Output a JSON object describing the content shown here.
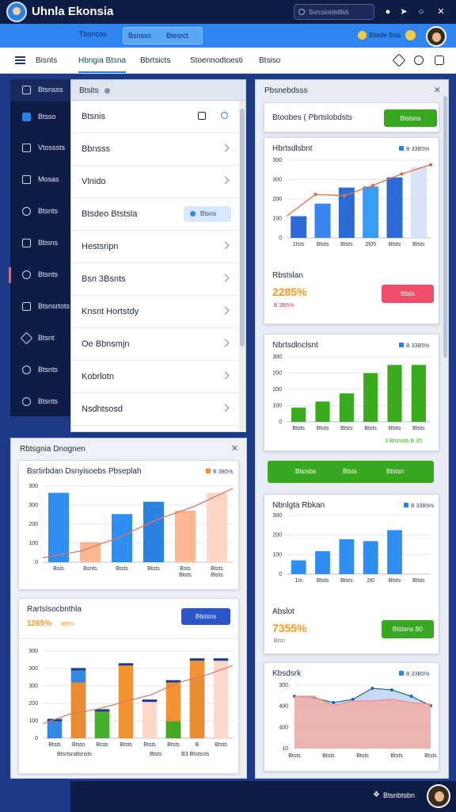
{
  "app": {
    "title": "Uhnla Ekonsia"
  },
  "titlebar": {
    "search_placeholder": "Ssrcsiotdslllsti"
  },
  "ribbon": {
    "button1": "Tboncos",
    "seg1": "Bsnsss",
    "seg2": "Btesrct",
    "user_label": "Bbsde Bsts"
  },
  "tabs": {
    "home": "Bisnts",
    "items": [
      {
        "label": "Hbngia Btsna",
        "active": true
      },
      {
        "label": "Bbrtsicts",
        "active": false
      },
      {
        "label": "Stoennodtoesti",
        "active": false
      },
      {
        "label": "Btsiso",
        "active": false
      }
    ]
  },
  "sidebar": {
    "items": [
      {
        "label": "Btsnsss",
        "icon": "document-icon"
      },
      {
        "label": "Btsso",
        "icon": "calendar-icon"
      },
      {
        "label": "Vtosssts",
        "icon": "grid-icon"
      },
      {
        "label": "Mosas",
        "icon": "mail-icon"
      },
      {
        "label": "Btsnts",
        "icon": "chat-icon"
      },
      {
        "label": "Bbsns",
        "icon": "box-icon"
      },
      {
        "label": "Btsnts",
        "icon": "alert-icon"
      },
      {
        "label": "Btsnsrtots",
        "icon": "list-icon"
      },
      {
        "label": "Btsnt",
        "icon": "pen-icon"
      },
      {
        "label": "Btsnts",
        "icon": "settings-icon"
      },
      {
        "label": "Btsnts",
        "icon": "help-icon"
      }
    ]
  },
  "list_panel": {
    "title": "Btsits",
    "rows": [
      {
        "label": "Btsnis"
      },
      {
        "label": "Bbnsss"
      },
      {
        "label": "Vlnido"
      },
      {
        "label": "Btsdeo Btstsla",
        "dropdown": "Btsns"
      },
      {
        "label": "Hestsripn"
      },
      {
        "label": "Bsn 3Bsnts"
      },
      {
        "label": "Knsnt Hortstdy"
      },
      {
        "label": "Oe Bbnsmjn"
      },
      {
        "label": "Kobrlotn"
      },
      {
        "label": "Nsdhtsosd"
      }
    ]
  },
  "report_panel": {
    "title": "Rbtsgnia Dnognen",
    "chart1": {
      "title": "Bsrtirbdan Dsnyisoebs Pbseplah",
      "badge": "B 3B5%",
      "chart_data": {
        "type": "bar",
        "categories": [
          "Bsts",
          "Bsnts",
          "Btsts",
          "Btsts",
          "Bsts Btsts",
          "Btsts Btsts"
        ],
        "values": [
          310,
          90,
          215,
          270,
          230,
          310
        ],
        "colors": [
          "#2e8ff0",
          "#fdb893",
          "#2e8ff0",
          "#2c82e0",
          "#fdb893",
          "#fdd6c8"
        ],
        "line": [
          20,
          50,
          110,
          190,
          250,
          330
        ],
        "yticks": [
          "0",
          "100",
          "200",
          "300",
          "300"
        ],
        "ylim": [
          0,
          340
        ]
      }
    },
    "chart2": {
      "title": "Rartslsocbnthla",
      "button": "Btstsns",
      "kpi_value": "1265%",
      "kpi_sub": "365%",
      "chart_data": {
        "type": "bar",
        "categories": [
          "Btsts",
          "Btsto",
          "Btsts",
          "Btsts",
          "Btsts",
          "Btsts",
          "B",
          "Btsts"
        ],
        "stacks": [
          {
            "name": "blue",
            "values": [
              70,
              280,
              0,
              0,
              0,
              0,
              250,
              0
            ]
          },
          {
            "name": "orange",
            "values": [
              0,
              230,
              0,
              300,
              0,
              230,
              320,
              0
            ]
          },
          {
            "name": "green",
            "values": [
              0,
              0,
              110,
              0,
              0,
              70,
              0,
              0
            ]
          },
          {
            "name": "peach",
            "values": [
              0,
              0,
              0,
              0,
              150,
              0,
              0,
              320
            ]
          }
        ],
        "line": [
          60,
          100,
          120,
          150,
          180,
          230,
          260,
          300
        ],
        "yticks": [
          "0",
          "100",
          "200",
          "300",
          "300",
          "300"
        ],
        "ylim": [
          0,
          360
        ],
        "footer_left": "Btsrtsndtsnsts",
        "footer_mid": "Btsts",
        "footer_right": "B3 Btstsnts"
      }
    }
  },
  "right_panel": {
    "title": "Pbsnebdsss",
    "toolbar_label": "Btoobes ( Pbrtslobdsts",
    "toolbar_button": "Btstsns",
    "chart1": {
      "title": "Hbrtsdlsbnt",
      "badge": "B 33B5%",
      "chart_data": {
        "type": "bar",
        "categories": [
          "1tsts",
          "Btsts",
          "Btsts",
          "2t05",
          "Btsts",
          "Btsts"
        ],
        "values": [
          95,
          150,
          220,
          225,
          265,
          310
        ],
        "colors": [
          "#2c6ad6",
          "#3a86f0",
          "#2c6ad6",
          "#3a9cf6",
          "#2c6ad6",
          "#d8e3f6"
        ],
        "line": [
          95,
          190,
          185,
          230,
          280,
          320
        ],
        "yticks": [
          "0",
          "100",
          "200",
          "300",
          "300"
        ],
        "ylim": [
          0,
          340
        ]
      },
      "kpi_label": "Rbstslan",
      "kpi_value": "2285%",
      "kpi_sub": "B 3B5%",
      "kpi_button": "Btsts"
    },
    "chart2": {
      "title": "Nbrtsdlnclsnt",
      "badge": "B 33B5%",
      "chart_data": {
        "type": "bar",
        "categories": [
          "Btsts",
          "Btsts",
          "Btsts",
          "Btsts",
          "Btsts",
          "Btsts"
        ],
        "values": [
          70,
          100,
          140,
          240,
          280,
          280
        ],
        "color": "#3aab1f",
        "yticks": [
          "0",
          "100",
          "200",
          "200",
          "300"
        ],
        "ylim": [
          0,
          320
        ],
        "footer": "3 Btstsnts B 35"
      },
      "buttons": [
        "Btstsbs",
        "Btsts",
        "Btstsn"
      ]
    },
    "chart3": {
      "title": "Nbnlgta Rbkan",
      "badge": "B 33B5%",
      "chart_data": {
        "type": "bar",
        "categories": [
          "1ts",
          "Btsts",
          "Btsts",
          "2t0",
          "Btsts",
          "Btsts"
        ],
        "values": [
          75,
          125,
          190,
          180,
          240
        ],
        "color": "#2e8ff0",
        "yticks": [
          "0",
          "100",
          "200",
          "300"
        ],
        "ylim": [
          0,
          320
        ]
      },
      "kpi_label": "Abslot",
      "kpi_value": "7355%",
      "kpi_sub": "Btsn",
      "kpi_button": "Btstsns B0"
    },
    "chart4": {
      "title": "Kbsdsrk",
      "badge": "B 33B5%",
      "chart_data": {
        "type": "area",
        "categories": [
          "Btsts",
          "Btsts",
          "Btsts",
          "Btsts",
          "Btsts"
        ],
        "series": [
          {
            "values": [
              330,
              320,
              290,
              310,
              380,
              370,
              330,
              270
            ],
            "color": "#1f7a87"
          },
          {
            "values": [
              330,
              330,
              270,
              300,
              300,
              310,
              290,
              280
            ],
            "color": "#f38a8a"
          }
        ],
        "yticks": [
          "10",
          "400",
          "400",
          "300"
        ],
        "ylim": [
          0,
          400
        ]
      }
    }
  },
  "bottombar": {
    "label": "Btsnbtsbn"
  }
}
